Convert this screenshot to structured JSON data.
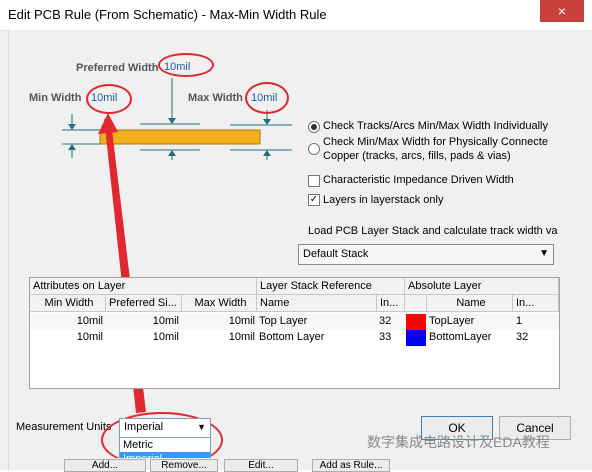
{
  "window": {
    "title": "Edit PCB Rule (From Schematic) - Max-Min Width Rule",
    "close_glyph": "×"
  },
  "diagram": {
    "preferred_label": "Preferred Width",
    "preferred_value": "10mil",
    "min_label": "Min Width",
    "min_value": "10mil",
    "max_label": "Max Width",
    "max_value": "10mil",
    "track_color": "#f2b01e"
  },
  "options": {
    "radio1": "Check Tracks/Arcs Min/Max Width Individually",
    "radio2_line1": "Check Min/Max Width for Physically Connecte",
    "radio2_line2": "Copper (tracks, arcs, fills, pads & vias)",
    "check1": "Characteristic Impedance Driven Width",
    "check2": "Layers in layerstack only",
    "check_mark": "✓",
    "load_label": "Load PCB Layer Stack and calculate track width va",
    "stack_select": "Default Stack"
  },
  "grid": {
    "group_headers": [
      "Attributes on Layer",
      "Layer Stack Reference",
      "Absolute Layer"
    ],
    "columns": [
      "Min Width",
      "Preferred Si...",
      "Max Width",
      "Name",
      "In...",
      "Name",
      "In..."
    ],
    "rows": [
      {
        "min": "10mil",
        "pref": "10mil",
        "max": "10mil",
        "name": "Top Layer",
        "idx": "32",
        "color": "#ff0000",
        "abs_name": "TopLayer",
        "abs_idx": "1"
      },
      {
        "min": "10mil",
        "pref": "10mil",
        "max": "10mil",
        "name": "Bottom Layer",
        "idx": "33",
        "color": "#0000ff",
        "abs_name": "BottomLayer",
        "abs_idx": "32"
      }
    ]
  },
  "units": {
    "label": "Measurement Units",
    "selected": "Imperial",
    "options": [
      "Metric",
      "Imperial"
    ]
  },
  "buttons": {
    "ok": "OK",
    "cancel": "Cancel"
  },
  "bottom_buttons": [
    "Add...",
    "Remove...",
    "Edit...",
    "Add as Rule..."
  ],
  "watermark": "数字集成电路设计及EDA教程",
  "annotation_color": "#e0282e"
}
